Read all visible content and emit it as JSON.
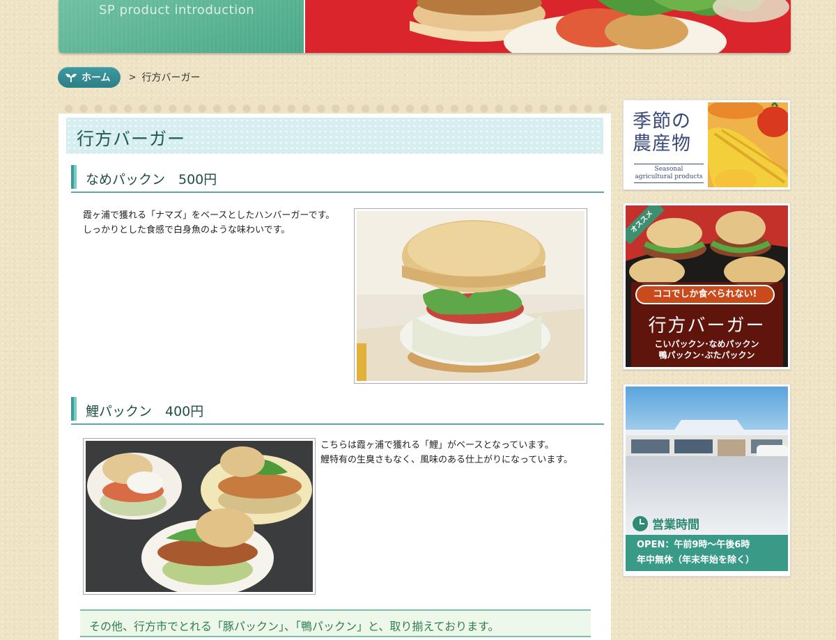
{
  "banner": {
    "subtitle": "SP product introduction"
  },
  "breadcrumb": {
    "home_label": "ホーム",
    "separator": ">",
    "current": "行方バーガー"
  },
  "page": {
    "title": "行方バーガー",
    "sections": [
      {
        "title": "なめパックン　500円",
        "lines": [
          "霞ヶ浦で獲れる「ナマズ」をベースとしたハンバーガーです。",
          "しっかりとした食感で白身魚のような味わいです。"
        ]
      },
      {
        "title": "鯉パックン　400円",
        "lines": [
          "こちらは霞ヶ浦で獲れる「鯉」がベースとなっています。",
          "鯉特有の生臭さもなく、風味のある仕上がりになっています。"
        ]
      }
    ],
    "footer_note": "その他、行方市でとれる「豚パックン」、「鴨パックン」と、取り揃えております。"
  },
  "sidebar": {
    "seasonal": {
      "title_line1": "季節の",
      "title_line2": "農産物",
      "en_line1": "Seasonal",
      "en_line2": "agricultural products"
    },
    "burger": {
      "tag": "オススメ",
      "pill": "ココでしか食べられない!",
      "title": "行方バーガー",
      "list_line1": "こいパックン･なめパックン",
      "list_line2": "鴨パックン･ぶたパックン"
    },
    "hours": {
      "label": "営業時間",
      "open": "OPEN：午前9時〜午後6時",
      "holiday": "年中無休（年末年始を除く）"
    }
  },
  "colors": {
    "background": "#efe3c6",
    "accent_green": "#4aa888",
    "heading_bg": "#d6eef0",
    "home_pill": "#2c7f86"
  }
}
